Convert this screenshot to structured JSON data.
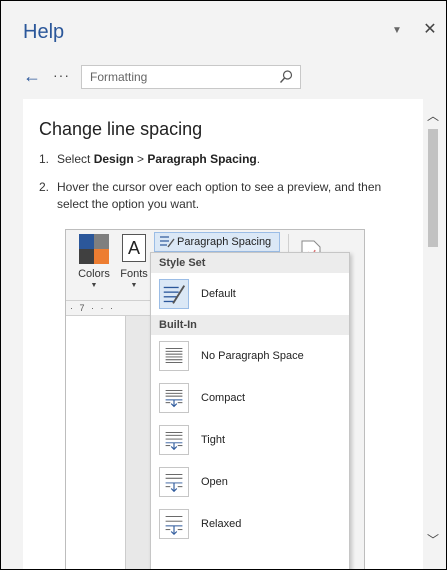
{
  "pane": {
    "title": "Help",
    "dropdown_icon": "chevron-down-icon",
    "close_icon": "close-icon"
  },
  "nav": {
    "back_icon": "back-arrow-icon",
    "more_label": "···",
    "search_value": "Formatting",
    "search_icon": "search-icon"
  },
  "article": {
    "title": "Change line spacing",
    "steps": [
      {
        "num": "1.",
        "pre": "Select ",
        "bold1": "Design",
        "mid": " > ",
        "bold2": "Paragraph Spacing",
        "post": "."
      },
      {
        "num": "2.",
        "text": "Hover the cursor over each option to see a preview, and then select the option you want."
      }
    ]
  },
  "screenshot": {
    "colors_label": "Colors",
    "fonts_label": "Fonts",
    "fonts_glyph": "A",
    "ps_button_label": "Paragraph Spacing ▾",
    "ruler_text": "· 7 · · ·",
    "swatch_colors": [
      "#2b579a",
      "#7f7f7f",
      "#404040",
      "#ed7d31"
    ],
    "menu": {
      "style_set_header": "Style Set",
      "default_label": "Default",
      "built_in_header": "Built-In",
      "items": [
        "No Paragraph Space",
        "Compact",
        "Tight",
        "Open",
        "Relaxed"
      ]
    }
  },
  "colors": {
    "accent": "#2b579a"
  }
}
